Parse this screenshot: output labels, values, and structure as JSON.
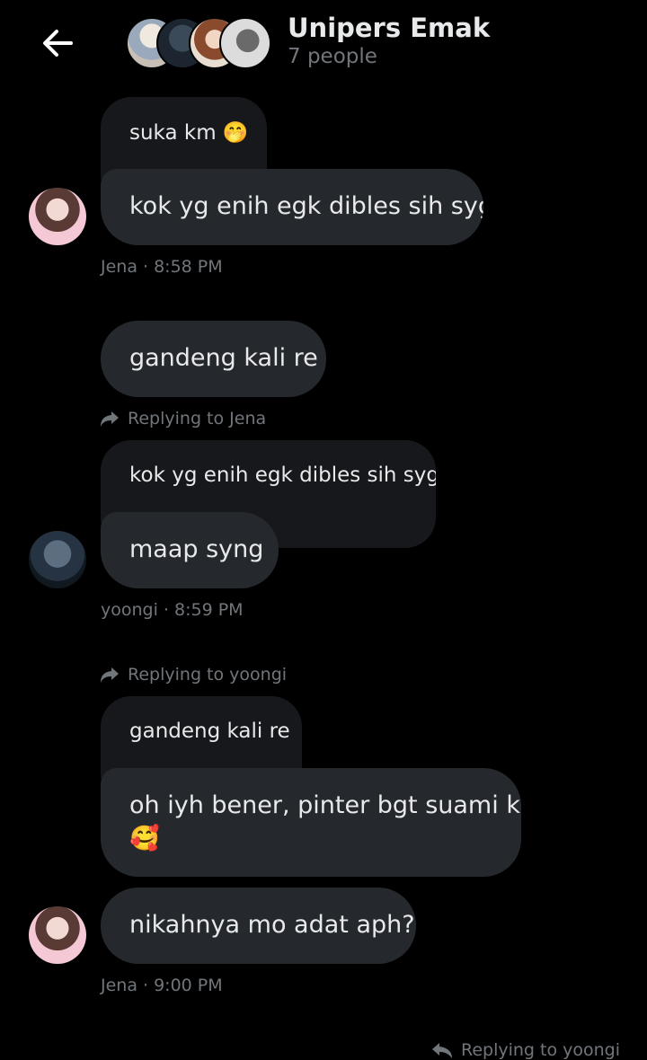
{
  "header": {
    "title": "Unipers Emak",
    "subtitle": "7 people"
  },
  "messages": {
    "m1": {
      "quoted_text": "suka km 🤭",
      "text": "kok yg enih egk dibles sih syg",
      "meta": "Jena · 8:58 PM"
    },
    "m2": {
      "text": "gandeng kali re"
    },
    "m3": {
      "reply_context": "Replying to Jena",
      "quoted_text": "kok yg enih egk dibles sih syg",
      "text": "maap syng",
      "meta": "yoongi · 8:59 PM"
    },
    "m4": {
      "reply_context": "Replying to yoongi",
      "quoted_text": "gandeng kali re",
      "text_line1": "oh iyh bener, pinter bgt suami ku",
      "text_line2": "🥰"
    },
    "m5": {
      "text": "nikahnya mo adat aph?",
      "meta": "Jena · 9:00 PM"
    },
    "m6": {
      "reply_context": "Replying to yoongi"
    }
  },
  "colors": {
    "background": "#000000",
    "bubble_main": "#25282d",
    "bubble_quoted": "#16181c",
    "text_primary": "#e7e9ea",
    "text_secondary": "#71767b"
  },
  "icons": {
    "back": "arrow-left-icon",
    "reply_context": "share-arrow-icon",
    "reply": "reply-arrow-icon"
  }
}
